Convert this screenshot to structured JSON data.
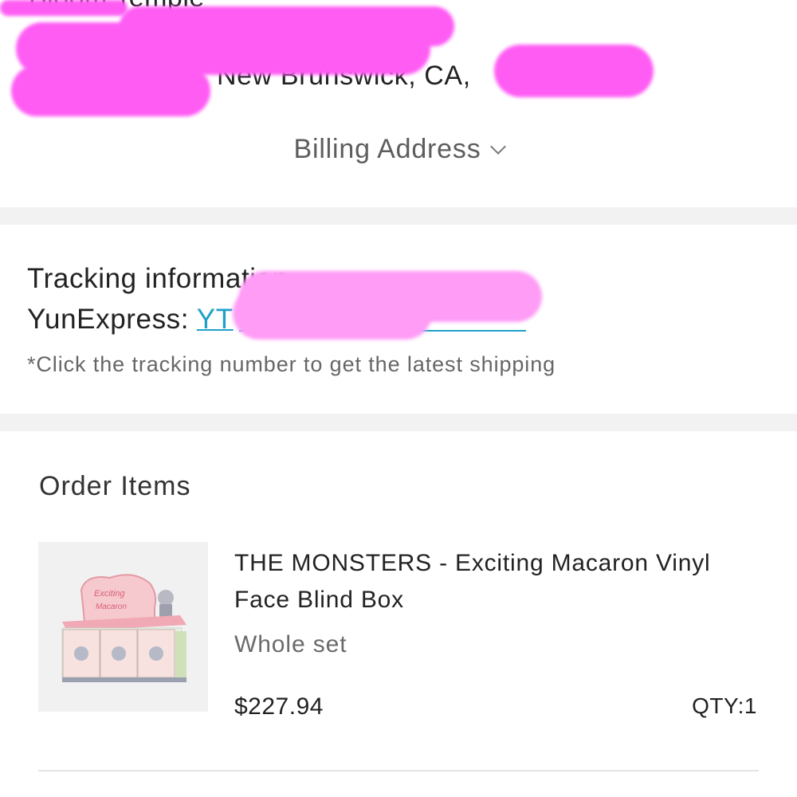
{
  "address": {
    "top_line_partial": "Bloom Temple",
    "city_line": "New Brunswick, CA,"
  },
  "billing": {
    "label": "Billing Address"
  },
  "tracking": {
    "title": "Tracking information",
    "carrier_prefix": "YunExpress: ",
    "tracking_number_visible": "YT",
    "note": "*Click the tracking number to get the latest shipping"
  },
  "order": {
    "title": "Order Items",
    "items": [
      {
        "name": "THE MONSTERS - Exciting Macaron Vinyl Face Blind Box",
        "variant": "Whole set",
        "price": "$227.94",
        "qty": "QTY:1",
        "image_icon": "product-image"
      }
    ]
  },
  "colors": {
    "link": "#1fa0c9",
    "redaction": "#ff5cf4",
    "divider": "#f2f2f2"
  }
}
